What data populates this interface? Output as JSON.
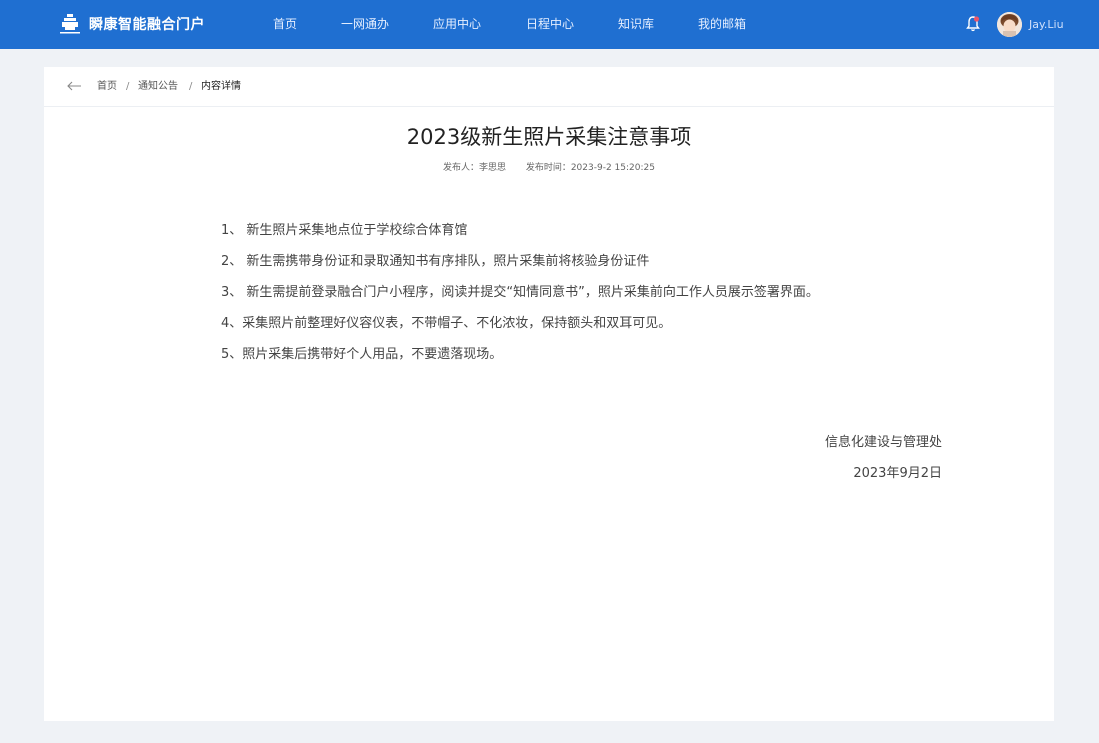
{
  "header": {
    "brand_title": "瞬康智能融合门户",
    "nav": [
      "首页",
      "一网通办",
      "应用中心",
      "日程中心",
      "知识库",
      "我的邮箱"
    ],
    "username": "Jay.Liu",
    "colors": {
      "bar": "#1f6fd1",
      "bell": "#e8556a"
    }
  },
  "breadcrumb": {
    "back_icon": "arrow-left-icon",
    "items": [
      "首页",
      "通知公告",
      "内容详情"
    ],
    "separator": "/"
  },
  "article": {
    "title": "2023级新生照片采集注意事项",
    "publisher_label": "发布人：",
    "publisher": "李思思",
    "time_label": "发布时间：",
    "time": "2023-9-2 15:20:25",
    "items": [
      "1、 新生照片采集地点位于学校综合体育馆",
      "2、 新生需携带身份证和录取通知书有序排队，照片采集前将核验身份证件",
      "3、 新生需提前登录融合门户小程序，阅读并提交“知情同意书”，照片采集前向工作人员展示签署界面。",
      "4、采集照片前整理好仪容仪表，不带帽子、不化浓妆，保持额头和双耳可见。",
      "5、照片采集后携带好个人用品，不要遗落现场。"
    ],
    "signature_org": "信息化建设与管理处",
    "signature_date": "2023年9月2日"
  }
}
